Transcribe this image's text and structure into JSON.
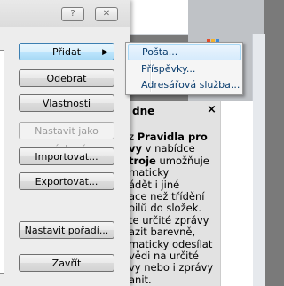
{
  "window": {
    "help_button": "?",
    "close_button": "✕"
  },
  "buttons": {
    "add": "Přidat",
    "remove": "Odebrat",
    "properties": "Vlastnosti",
    "set_default": "Nastavit jako výchozí",
    "import": "Importovat...",
    "export": "Exportovat...",
    "set_order": "Nastavit pořadí...",
    "close": "Zavřít"
  },
  "add_menu": {
    "items": [
      "Pošta...",
      "Příspěvky...",
      "Adresářová služba..."
    ]
  },
  "help_pane": {
    "header": "dne",
    "close": "×",
    "lines": [
      [
        "z ",
        "Pravidla pro"
      ],
      [
        "vy",
        " v nabídce"
      ],
      [
        "troje",
        " umožňuje"
      ],
      [
        "maticky",
        ""
      ],
      [
        "ádět i jiné",
        ""
      ],
      [
        "ace než třídění",
        ""
      ],
      [
        "oilů do složek.",
        ""
      ],
      [
        "te určité zprávy",
        ""
      ],
      [
        "azit barevně,",
        ""
      ],
      [
        "maticky odesílat",
        ""
      ],
      [
        "vědi na určité",
        ""
      ],
      [
        "vy nebo i zprávy",
        ""
      ],
      [
        "anit.",
        ""
      ]
    ]
  },
  "colors": {
    "menu_text": "#0a3d6e",
    "menu_highlight": "#d6ebfc"
  }
}
